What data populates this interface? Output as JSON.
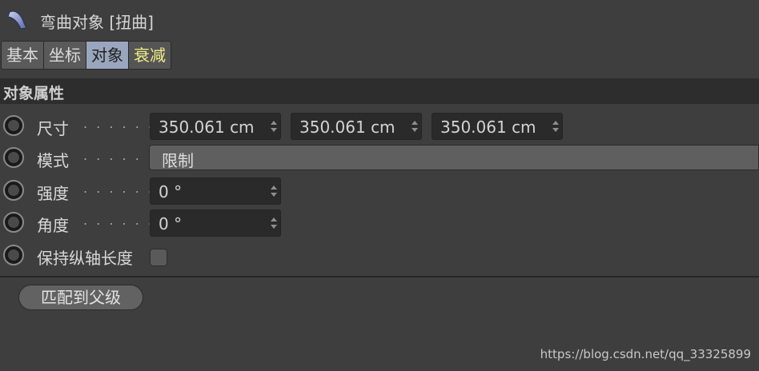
{
  "header": {
    "title": "弯曲对象 [扭曲]",
    "icon": "bend-deformer-icon"
  },
  "tabs": [
    {
      "label": "基本",
      "active": false
    },
    {
      "label": "坐标",
      "active": false
    },
    {
      "label": "对象",
      "active": true
    },
    {
      "label": "衰减",
      "active": false,
      "highlight_color": "#f1ee86"
    }
  ],
  "section": {
    "title": "对象属性"
  },
  "properties": {
    "size": {
      "label": "尺寸",
      "dots": ". . . . . . .",
      "values": [
        "350.061 cm",
        "350.061 cm",
        "350.061 cm"
      ]
    },
    "mode": {
      "label": "模式",
      "dots": ". . . . . . .",
      "value": "限制"
    },
    "strength": {
      "label": "强度",
      "dots": ". . . . . . .",
      "value": "0 °"
    },
    "angle": {
      "label": "角度",
      "dots": ". . . . . . .",
      "value": "0 °"
    },
    "keep_length": {
      "label": "保持纵轴长度",
      "checked": false
    }
  },
  "fit_button": {
    "label": "匹配到父级"
  },
  "watermark": "https://blog.csdn.net/qq_33325899",
  "colors": {
    "active_tab": "#9aa6bd",
    "panel_bg": "#3e3e3e",
    "field_bg": "#2a2a2a"
  }
}
